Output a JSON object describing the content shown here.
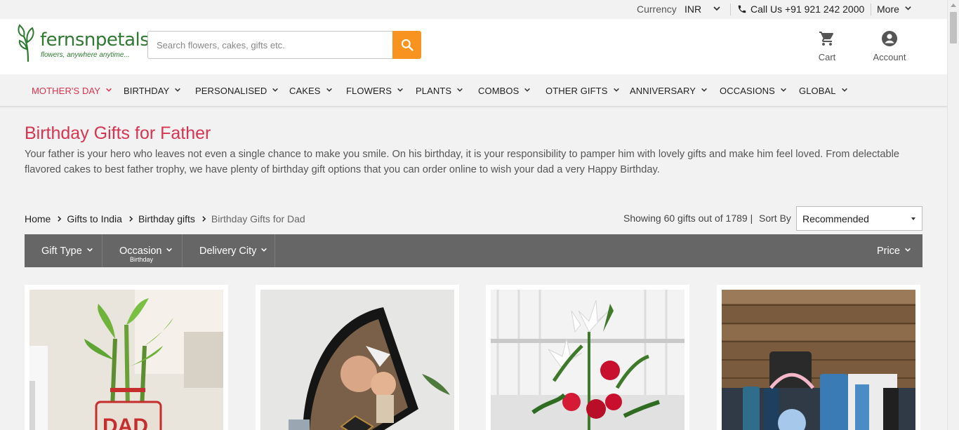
{
  "topbar": {
    "currency_label": "Currency",
    "currency_value": "INR",
    "call_label": "Call Us +91 921 242 2000",
    "more_label": "More"
  },
  "header": {
    "logo_word": "fernsnpetals",
    "logo_tagline": "flowers, anywhere anytime...",
    "search_placeholder": "Search flowers, cakes, gifts etc.",
    "cart_label": "Cart",
    "account_label": "Account"
  },
  "nav": {
    "items": [
      {
        "label": "MOTHER'S DAY"
      },
      {
        "label": "BIRTHDAY"
      },
      {
        "label": "PERSONALISED"
      },
      {
        "label": "CAKES"
      },
      {
        "label": "FLOWERS"
      },
      {
        "label": "PLANTS"
      },
      {
        "label": "COMBOS"
      },
      {
        "label": "OTHER GIFTS"
      },
      {
        "label": "ANNIVERSARY"
      },
      {
        "label": "OCCASIONS"
      },
      {
        "label": "GLOBAL"
      }
    ]
  },
  "page": {
    "title": "Birthday Gifts for Father",
    "intro": "Your father is your hero who leaves not even a single chance to make you smile. On his birthday, it is your responsibility to pamper him with lovely gifts and make him feel loved. From delectable flavored cakes to best father trophy, we have plenty of birthday gift options that you can order online to wish your dad a very Happy Birthday."
  },
  "breadcrumb": {
    "items": [
      "Home",
      "Gifts to India",
      "Birthday gifts",
      "Birthday Gifts for Dad"
    ]
  },
  "listing": {
    "showing": "Showing 60 gifts out of 1789 |",
    "sort_label": "Sort By",
    "sort_value": "Recommended"
  },
  "filters": {
    "gift_type": "Gift Type",
    "occasion": "Occasion",
    "occasion_sub": "Birthday",
    "delivery_city": "Delivery City",
    "price": "Price"
  },
  "colors": {
    "accent_red": "#d9344f",
    "search_orange": "#f7931e",
    "brand_green": "#2f7a31",
    "filter_bar": "#666666"
  }
}
